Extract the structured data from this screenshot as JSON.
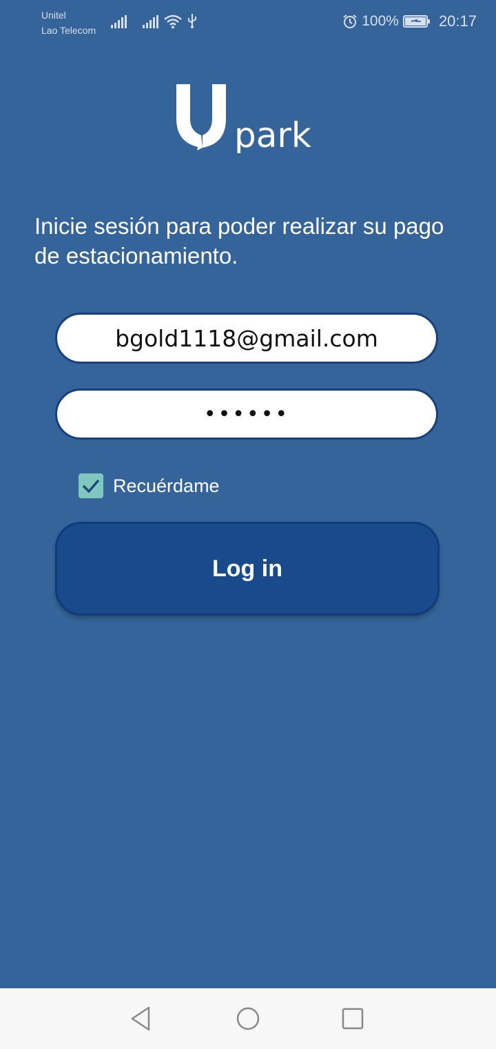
{
  "status_bar": {
    "carrier_1": "Unitel",
    "carrier_2": "Lao Telecom",
    "battery_percent": "100%",
    "time": "20:17",
    "icons": [
      "signal-icon",
      "signal-icon",
      "wifi-icon",
      "usb-icon",
      "alarm-icon",
      "battery-charging-icon"
    ]
  },
  "logo": {
    "text": "park",
    "mark": "U"
  },
  "intro_text": "Inicie sesión para poder realizar su pago de estacionamiento.",
  "email_field": {
    "value": "bgold1118@gmail.com"
  },
  "password_field": {
    "value": "••••••"
  },
  "remember_me": {
    "label": "Recuérdame",
    "checked": true
  },
  "login_button": {
    "label": "Log in"
  },
  "colors": {
    "background": "#35649a",
    "button": "#194b8c",
    "checkbox": "#7fc7bf"
  },
  "nav_bar": {
    "icons": [
      "back-icon",
      "home-icon",
      "recents-icon"
    ]
  }
}
